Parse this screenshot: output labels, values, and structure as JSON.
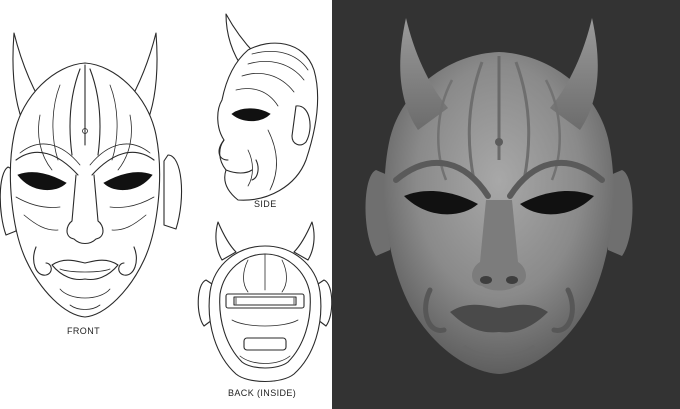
{
  "views": {
    "front_label": "FRONT",
    "side_label": "SIDE",
    "back_label": "BACK (INSIDE)"
  },
  "colors": {
    "line_art_background": "#ffffff",
    "line_color": "#2a2a2a",
    "render_background": "#333333",
    "mask_sculpt": "#8a8a8a"
  }
}
